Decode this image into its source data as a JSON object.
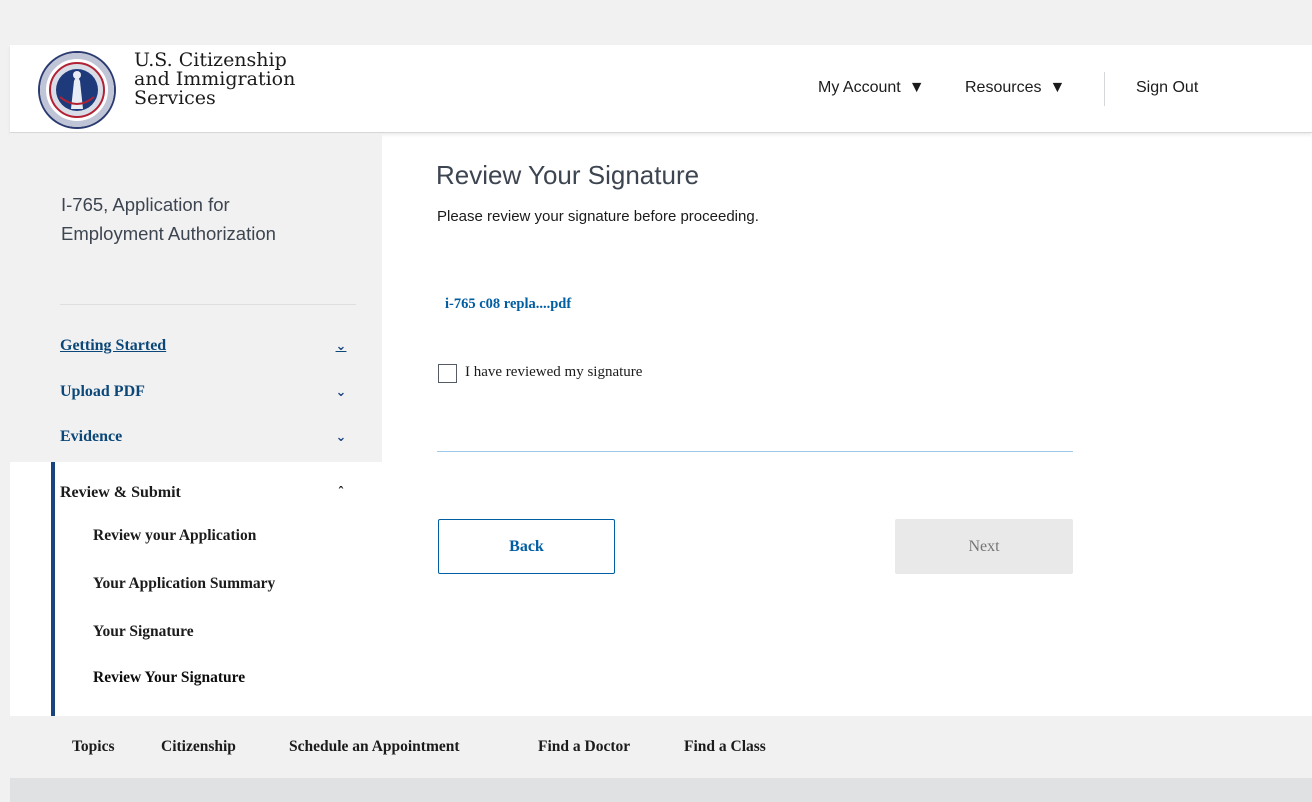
{
  "header": {
    "agency_line1": "U.S. Citizenship",
    "agency_line2": "and Immigration",
    "agency_line3": "Services",
    "nav": {
      "my_account": "My Account",
      "resources": "Resources",
      "sign_out": "Sign Out"
    }
  },
  "sidebar": {
    "form_title": "I-765, Application for Employment Authorization",
    "sections": [
      {
        "label": "Getting Started",
        "expanded": false
      },
      {
        "label": "Upload PDF",
        "expanded": false
      },
      {
        "label": "Evidence",
        "expanded": false
      },
      {
        "label": "Review & Submit",
        "expanded": true
      }
    ],
    "subitems": [
      {
        "label": "Review your Application"
      },
      {
        "label": "Your Application Summary"
      },
      {
        "label": "Your Signature"
      },
      {
        "label": "Review Your Signature",
        "current": true
      }
    ]
  },
  "main": {
    "title": "Review Your Signature",
    "subtitle": "Please review your signature before proceeding.",
    "file_link": "i-765 c08 repla....pdf",
    "checkbox_label": "I have reviewed my signature",
    "checkbox_checked": false,
    "back_label": "Back",
    "next_label": "Next",
    "next_disabled": true
  },
  "footer": {
    "links": [
      "Topics",
      "Citizenship",
      "Schedule an Appointment",
      "Find a Doctor",
      "Find a Class"
    ]
  },
  "colors": {
    "link_blue": "#005ea2",
    "nav_blue": "#0b4778",
    "active_border": "#1a4480",
    "sidebar_gray": "#f1f1f1"
  }
}
